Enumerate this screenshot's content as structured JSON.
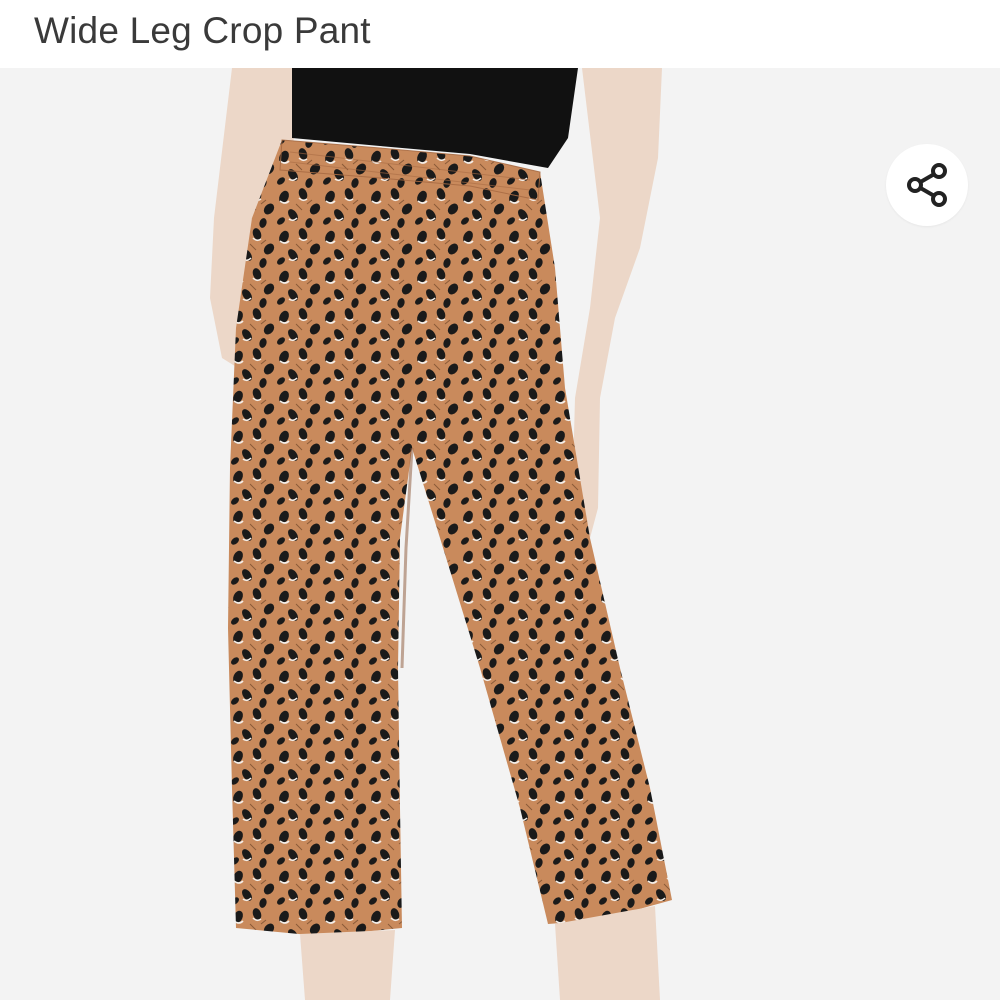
{
  "product": {
    "title": "Wide Leg Crop Pant"
  },
  "share_button": {
    "icon": "share-icon"
  },
  "colors": {
    "background": "#f3f3f3",
    "pant_fabric": "#c98a5c",
    "top": "#111111",
    "skin": "#ecd7c8",
    "title_text": "#3a3a3a"
  }
}
